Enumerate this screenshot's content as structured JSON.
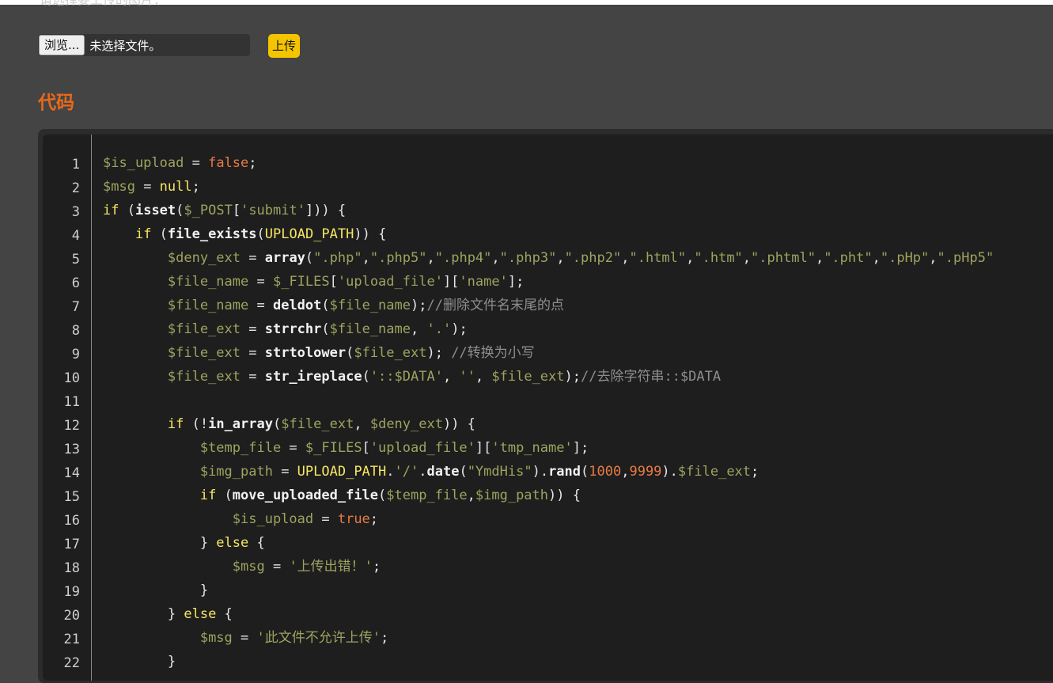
{
  "upload_form": {
    "prompt_text": "请选择要上传的图片：",
    "browse_label": "浏览...",
    "file_status": "未选择文件。",
    "upload_label": "上传"
  },
  "code_section": {
    "title": "代码",
    "lines": [
      {
        "n": "1",
        "tokens": [
          [
            "var",
            "$is_upload"
          ],
          [
            "op",
            " = "
          ],
          [
            "bool",
            "false"
          ],
          [
            "op",
            ";"
          ]
        ]
      },
      {
        "n": "2",
        "tokens": [
          [
            "var",
            "$msg"
          ],
          [
            "op",
            " = "
          ],
          [
            "key",
            "null"
          ],
          [
            "op",
            ";"
          ]
        ]
      },
      {
        "n": "3",
        "tokens": [
          [
            "key",
            "if"
          ],
          [
            "op",
            " ("
          ],
          [
            "fn",
            "isset"
          ],
          [
            "op",
            "("
          ],
          [
            "var",
            "$_POST"
          ],
          [
            "op",
            "["
          ],
          [
            "str",
            "'submit'"
          ],
          [
            "op",
            "])) {"
          ]
        ]
      },
      {
        "n": "4",
        "tokens": [
          [
            "op",
            "    "
          ],
          [
            "key",
            "if"
          ],
          [
            "op",
            " ("
          ],
          [
            "fn",
            "file_exists"
          ],
          [
            "op",
            "("
          ],
          [
            "key",
            "UPLOAD_PATH"
          ],
          [
            "op",
            ")) {"
          ]
        ]
      },
      {
        "n": "5",
        "tokens": [
          [
            "op",
            "        "
          ],
          [
            "var",
            "$deny_ext"
          ],
          [
            "op",
            " = "
          ],
          [
            "fn",
            "array"
          ],
          [
            "op",
            "("
          ],
          [
            "str",
            "\".php\""
          ],
          [
            "op",
            ","
          ],
          [
            "str",
            "\".php5\""
          ],
          [
            "op",
            ","
          ],
          [
            "str",
            "\".php4\""
          ],
          [
            "op",
            ","
          ],
          [
            "str",
            "\".php3\""
          ],
          [
            "op",
            ","
          ],
          [
            "str",
            "\".php2\""
          ],
          [
            "op",
            ","
          ],
          [
            "str",
            "\".html\""
          ],
          [
            "op",
            ","
          ],
          [
            "str",
            "\".htm\""
          ],
          [
            "op",
            ","
          ],
          [
            "str",
            "\".phtml\""
          ],
          [
            "op",
            ","
          ],
          [
            "str",
            "\".pht\""
          ],
          [
            "op",
            ","
          ],
          [
            "str",
            "\".pHp\""
          ],
          [
            "op",
            ","
          ],
          [
            "str",
            "\".pHp5\""
          ]
        ]
      },
      {
        "n": "6",
        "tokens": [
          [
            "op",
            "        "
          ],
          [
            "var",
            "$file_name"
          ],
          [
            "op",
            " = "
          ],
          [
            "var",
            "$_FILES"
          ],
          [
            "op",
            "["
          ],
          [
            "str",
            "'upload_file'"
          ],
          [
            "op",
            "]["
          ],
          [
            "str",
            "'name'"
          ],
          [
            "op",
            "];"
          ]
        ]
      },
      {
        "n": "7",
        "tokens": [
          [
            "op",
            "        "
          ],
          [
            "var",
            "$file_name"
          ],
          [
            "op",
            " = "
          ],
          [
            "fn",
            "deldot"
          ],
          [
            "op",
            "("
          ],
          [
            "var",
            "$file_name"
          ],
          [
            "op",
            ");"
          ],
          [
            "com",
            "//删除文件名末尾的点"
          ]
        ]
      },
      {
        "n": "8",
        "tokens": [
          [
            "op",
            "        "
          ],
          [
            "var",
            "$file_ext"
          ],
          [
            "op",
            " = "
          ],
          [
            "fn",
            "strrchr"
          ],
          [
            "op",
            "("
          ],
          [
            "var",
            "$file_name"
          ],
          [
            "op",
            ", "
          ],
          [
            "str",
            "'.'"
          ],
          [
            "op",
            ");"
          ]
        ]
      },
      {
        "n": "9",
        "tokens": [
          [
            "op",
            "        "
          ],
          [
            "var",
            "$file_ext"
          ],
          [
            "op",
            " = "
          ],
          [
            "fn",
            "strtolower"
          ],
          [
            "op",
            "("
          ],
          [
            "var",
            "$file_ext"
          ],
          [
            "op",
            "); "
          ],
          [
            "com",
            "//转换为小写"
          ]
        ]
      },
      {
        "n": "10",
        "tokens": [
          [
            "op",
            "        "
          ],
          [
            "var",
            "$file_ext"
          ],
          [
            "op",
            " = "
          ],
          [
            "fn",
            "str_ireplace"
          ],
          [
            "op",
            "("
          ],
          [
            "str",
            "'::$DATA'"
          ],
          [
            "op",
            ", "
          ],
          [
            "str",
            "''"
          ],
          [
            "op",
            ", "
          ],
          [
            "var",
            "$file_ext"
          ],
          [
            "op",
            ");"
          ],
          [
            "com",
            "//去除字符串::$DATA"
          ]
        ]
      },
      {
        "n": "11",
        "tokens": []
      },
      {
        "n": "12",
        "tokens": [
          [
            "op",
            "        "
          ],
          [
            "key",
            "if"
          ],
          [
            "op",
            " (!"
          ],
          [
            "fn",
            "in_array"
          ],
          [
            "op",
            "("
          ],
          [
            "var",
            "$file_ext"
          ],
          [
            "op",
            ", "
          ],
          [
            "var",
            "$deny_ext"
          ],
          [
            "op",
            ")) {"
          ]
        ]
      },
      {
        "n": "13",
        "tokens": [
          [
            "op",
            "            "
          ],
          [
            "var",
            "$temp_file"
          ],
          [
            "op",
            " = "
          ],
          [
            "var",
            "$_FILES"
          ],
          [
            "op",
            "["
          ],
          [
            "str",
            "'upload_file'"
          ],
          [
            "op",
            "]["
          ],
          [
            "str",
            "'tmp_name'"
          ],
          [
            "op",
            "];"
          ]
        ]
      },
      {
        "n": "14",
        "tokens": [
          [
            "op",
            "            "
          ],
          [
            "var",
            "$img_path"
          ],
          [
            "op",
            " = "
          ],
          [
            "key",
            "UPLOAD_PATH"
          ],
          [
            "op",
            "."
          ],
          [
            "str",
            "'/'"
          ],
          [
            "op",
            "."
          ],
          [
            "fn",
            "date"
          ],
          [
            "op",
            "("
          ],
          [
            "str",
            "\"YmdHis\""
          ],
          [
            "op",
            ")."
          ],
          [
            "fn",
            "rand"
          ],
          [
            "op",
            "("
          ],
          [
            "num",
            "1000"
          ],
          [
            "op",
            ","
          ],
          [
            "num",
            "9999"
          ],
          [
            "op",
            ")."
          ],
          [
            "var",
            "$file_ext"
          ],
          [
            "op",
            ";"
          ]
        ]
      },
      {
        "n": "15",
        "tokens": [
          [
            "op",
            "            "
          ],
          [
            "key",
            "if"
          ],
          [
            "op",
            " ("
          ],
          [
            "fn",
            "move_uploaded_file"
          ],
          [
            "op",
            "("
          ],
          [
            "var",
            "$temp_file"
          ],
          [
            "op",
            ","
          ],
          [
            "var",
            "$img_path"
          ],
          [
            "op",
            ")) {"
          ]
        ]
      },
      {
        "n": "16",
        "tokens": [
          [
            "op",
            "                "
          ],
          [
            "var",
            "$is_upload"
          ],
          [
            "op",
            " = "
          ],
          [
            "bool",
            "true"
          ],
          [
            "op",
            ";"
          ]
        ]
      },
      {
        "n": "17",
        "tokens": [
          [
            "op",
            "            } "
          ],
          [
            "key",
            "else"
          ],
          [
            "op",
            " {"
          ]
        ]
      },
      {
        "n": "18",
        "tokens": [
          [
            "op",
            "                "
          ],
          [
            "var",
            "$msg"
          ],
          [
            "op",
            " = "
          ],
          [
            "str",
            "'上传出错！'"
          ],
          [
            "op",
            ";"
          ]
        ]
      },
      {
        "n": "19",
        "tokens": [
          [
            "op",
            "            }"
          ]
        ]
      },
      {
        "n": "20",
        "tokens": [
          [
            "op",
            "        } "
          ],
          [
            "key",
            "else"
          ],
          [
            "op",
            " {"
          ]
        ]
      },
      {
        "n": "21",
        "tokens": [
          [
            "op",
            "            "
          ],
          [
            "var",
            "$msg"
          ],
          [
            "op",
            " = "
          ],
          [
            "str",
            "'此文件不允许上传'"
          ],
          [
            "op",
            ";"
          ]
        ]
      },
      {
        "n": "22",
        "tokens": [
          [
            "op",
            "        }"
          ]
        ]
      }
    ]
  }
}
